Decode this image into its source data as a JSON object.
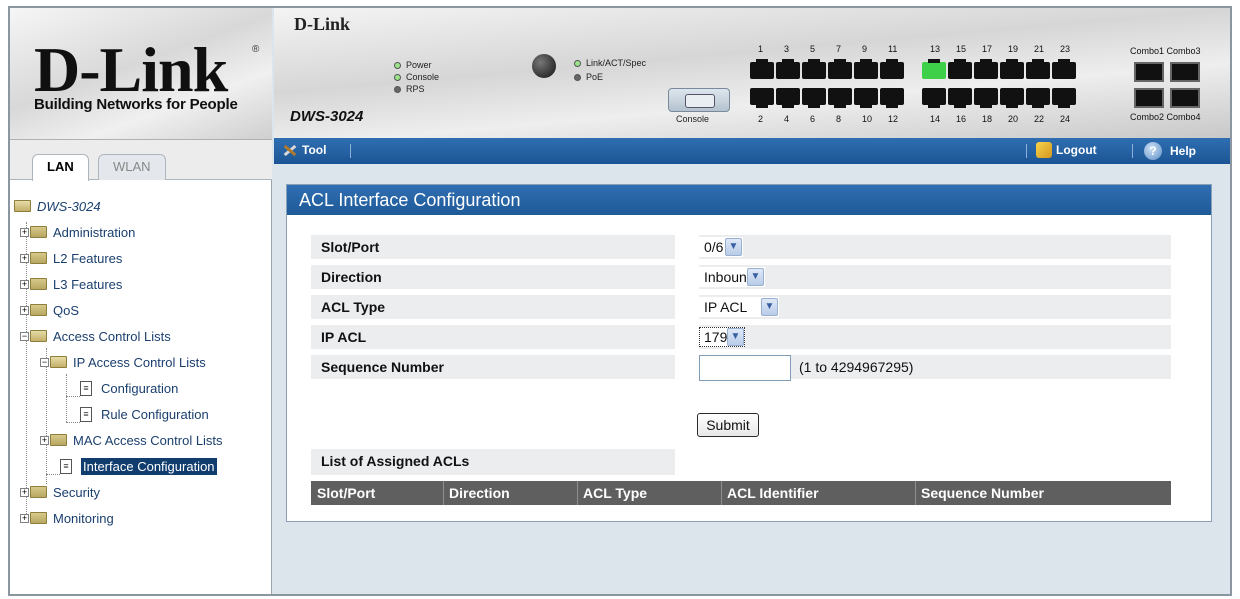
{
  "brand": {
    "logo_text": "D-Link",
    "logo_mark": "®",
    "tagline": "Building Networks for People"
  },
  "tabs": [
    {
      "label": "LAN",
      "active": true
    },
    {
      "label": "WLAN",
      "active": false
    }
  ],
  "tree": {
    "root": "DWS-3024",
    "items": [
      {
        "label": "Administration"
      },
      {
        "label": "L2 Features"
      },
      {
        "label": "L3 Features"
      },
      {
        "label": "QoS"
      },
      {
        "label": "Access Control Lists"
      },
      {
        "label": "IP Access Control Lists"
      },
      {
        "label": "Configuration"
      },
      {
        "label": "Rule Configuration"
      },
      {
        "label": "MAC Access Control Lists"
      },
      {
        "label": "Interface Configuration",
        "selected": true
      },
      {
        "label": "Security"
      },
      {
        "label": "Monitoring"
      }
    ]
  },
  "device_panel": {
    "brand": "D-Link",
    "model": "DWS-3024",
    "leds": [
      "Power",
      "Console",
      "RPS",
      "Link/ACT/Spec",
      "PoE"
    ],
    "console_label": "Console",
    "top_ports": [
      "1",
      "3",
      "5",
      "7",
      "9",
      "11",
      "13",
      "15",
      "17",
      "19",
      "21",
      "23"
    ],
    "bottom_ports": [
      "2",
      "4",
      "6",
      "8",
      "10",
      "12",
      "14",
      "16",
      "18",
      "20",
      "22",
      "24"
    ],
    "combo_top": "Combo1 Combo3",
    "combo_bottom": "Combo2 Combo4",
    "active_port": "13"
  },
  "toolbar": {
    "tool": "Tool",
    "logout": "Logout",
    "help": "Help",
    "help_glyph": "?"
  },
  "form": {
    "title": "ACL Interface Configuration",
    "fields": [
      {
        "label": "Slot/Port",
        "value": "0/6",
        "type": "select"
      },
      {
        "label": "Direction",
        "value": "Inbound",
        "type": "select"
      },
      {
        "label": "ACL Type",
        "value": "IP ACL",
        "type": "select"
      },
      {
        "label": "IP ACL",
        "value": "179",
        "type": "select"
      },
      {
        "label": "Sequence Number",
        "value": "",
        "hint": "(1 to 4294967295)",
        "type": "text"
      }
    ],
    "submit": "Submit",
    "assigned_label": "List of Assigned ACLs",
    "table_columns": [
      "Slot/Port",
      "Direction",
      "ACL Type",
      "ACL Identifier",
      "Sequence Number"
    ]
  },
  "colors": {
    "header_blue": "#1f5a98",
    "selected_node": "#103d6e",
    "port_active": "#3fd04a"
  }
}
